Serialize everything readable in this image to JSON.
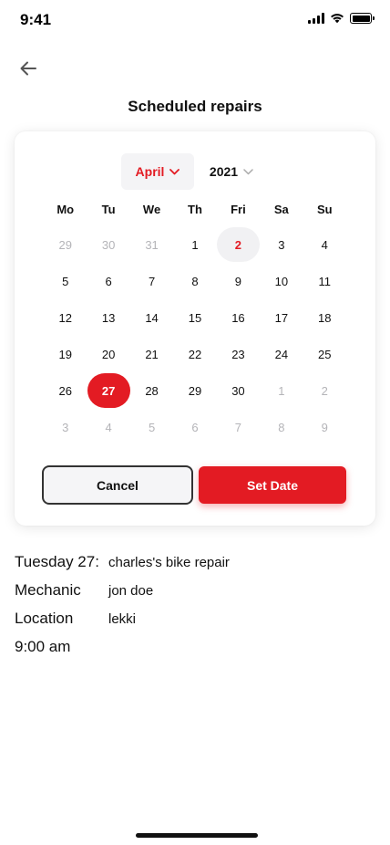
{
  "status_bar": {
    "time": "9:41"
  },
  "header": {
    "title": "Scheduled repairs"
  },
  "calendar": {
    "month": "April",
    "year": "2021",
    "weekdays": [
      "Mo",
      "Tu",
      "We",
      "Th",
      "Fri",
      "Sa",
      "Su"
    ],
    "days": [
      {
        "label": "29",
        "state": "muted"
      },
      {
        "label": "30",
        "state": "muted"
      },
      {
        "label": "31",
        "state": "muted"
      },
      {
        "label": "1",
        "state": "normal"
      },
      {
        "label": "2",
        "state": "today"
      },
      {
        "label": "3",
        "state": "normal"
      },
      {
        "label": "4",
        "state": "normal"
      },
      {
        "label": "5",
        "state": "normal"
      },
      {
        "label": "6",
        "state": "normal"
      },
      {
        "label": "7",
        "state": "normal"
      },
      {
        "label": "8",
        "state": "normal"
      },
      {
        "label": "9",
        "state": "normal"
      },
      {
        "label": "10",
        "state": "normal"
      },
      {
        "label": "11",
        "state": "normal"
      },
      {
        "label": "12",
        "state": "normal"
      },
      {
        "label": "13",
        "state": "normal"
      },
      {
        "label": "14",
        "state": "normal"
      },
      {
        "label": "15",
        "state": "normal"
      },
      {
        "label": "16",
        "state": "normal"
      },
      {
        "label": "17",
        "state": "normal"
      },
      {
        "label": "18",
        "state": "normal"
      },
      {
        "label": "19",
        "state": "normal"
      },
      {
        "label": "20",
        "state": "normal"
      },
      {
        "label": "21",
        "state": "normal"
      },
      {
        "label": "22",
        "state": "normal"
      },
      {
        "label": "23",
        "state": "normal"
      },
      {
        "label": "24",
        "state": "normal"
      },
      {
        "label": "25",
        "state": "normal"
      },
      {
        "label": "26",
        "state": "normal"
      },
      {
        "label": "27",
        "state": "selected"
      },
      {
        "label": "28",
        "state": "normal"
      },
      {
        "label": "29",
        "state": "normal"
      },
      {
        "label": "30",
        "state": "normal"
      },
      {
        "label": "1",
        "state": "muted"
      },
      {
        "label": "2",
        "state": "muted"
      },
      {
        "label": "3",
        "state": "muted"
      },
      {
        "label": "4",
        "state": "muted"
      },
      {
        "label": "5",
        "state": "muted"
      },
      {
        "label": "6",
        "state": "muted"
      },
      {
        "label": "7",
        "state": "muted"
      },
      {
        "label": "8",
        "state": "muted"
      },
      {
        "label": "9",
        "state": "muted"
      }
    ],
    "cancel_label": "Cancel",
    "set_date_label": "Set Date"
  },
  "details": {
    "date_label": "Tuesday 27:",
    "title_value": "charles's bike repair",
    "mechanic_label": "Mechanic",
    "mechanic_value": "jon doe",
    "location_label": "Location",
    "location_value": "lekki",
    "time": "9:00 am"
  },
  "colors": {
    "accent": "#e31b23",
    "muted": "#b4b4b8",
    "text": "#111111"
  },
  "icons": [
    "back-arrow-icon",
    "chevron-down-icon",
    "signal-icon",
    "wifi-icon",
    "battery-icon"
  ]
}
